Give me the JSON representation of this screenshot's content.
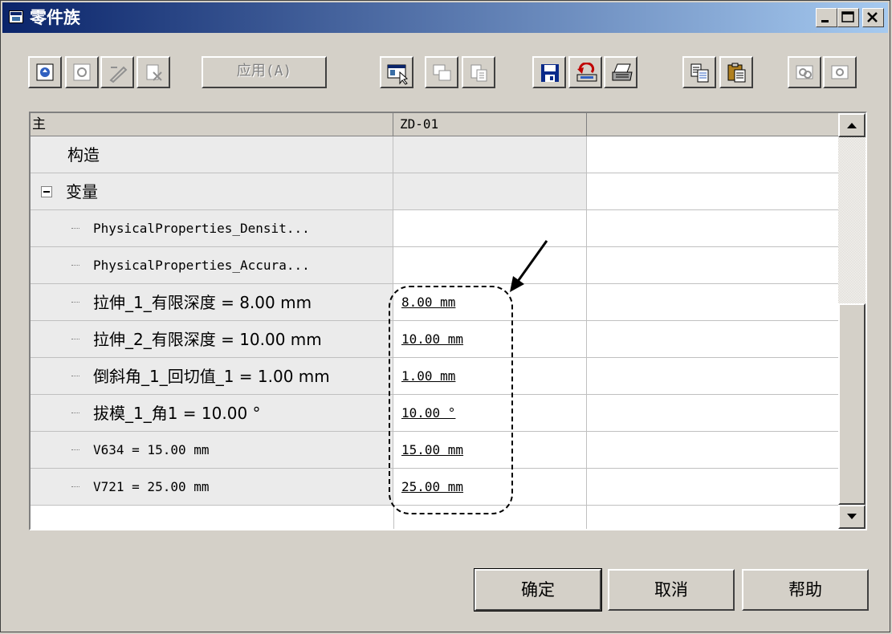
{
  "window": {
    "title": "零件族"
  },
  "toolbar": {
    "apply_label": "应用(A)"
  },
  "grid": {
    "headers": [
      "主",
      "ZD-01",
      ""
    ],
    "rows": [
      {
        "name": "构造",
        "value": ""
      },
      {
        "name": "变量",
        "value": ""
      },
      {
        "name": "PhysicalProperties_Densit...",
        "value": ""
      },
      {
        "name": "PhysicalProperties_Accura...",
        "value": ""
      },
      {
        "name": "拉伸_1_有限深度 = 8.00 mm",
        "value": "8.00 mm"
      },
      {
        "name": "拉伸_2_有限深度 = 10.00 mm",
        "value": "10.00 mm"
      },
      {
        "name": "倒斜角_1_回切值_1 = 1.00 mm",
        "value": "1.00 mm"
      },
      {
        "name": "拔模_1_角1 = 10.00 °",
        "value": "10.00 °"
      },
      {
        "name": "V634 = 15.00 mm",
        "value": "15.00 mm"
      },
      {
        "name": "V721 = 25.00 mm",
        "value": "25.00 mm"
      }
    ]
  },
  "buttons": {
    "ok": "确定",
    "cancel": "取消",
    "help": "帮助"
  },
  "colors": {
    "titlebar_start": "#0a246a",
    "titlebar_end": "#a6caf0",
    "face": "#d4d0c8"
  }
}
